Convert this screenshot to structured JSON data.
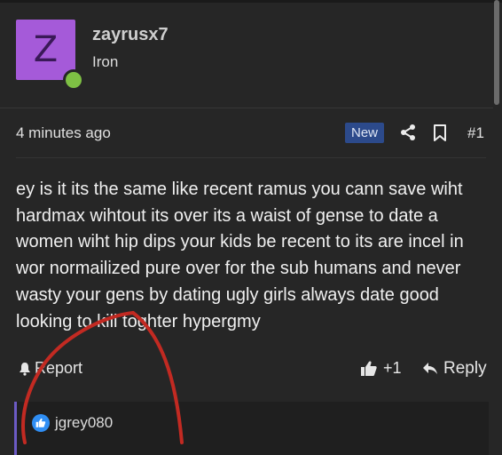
{
  "author": {
    "avatar_letter": "Z",
    "username": "zayrusx7",
    "rank": "Iron",
    "avatar_color": "#a55ad9",
    "online_color": "#7ec044"
  },
  "post_meta": {
    "time": "4 minutes ago",
    "badge": "New",
    "number": "#1",
    "share_icon": "share-icon",
    "bookmark_icon": "bookmark-icon"
  },
  "post": {
    "body": "ey is it its the same like recent ramus you cann save wiht hardmax wihtout its over its a waist of gense to date a women wiht hip dips your kids be recent to its are incel in wor normailized pure over for the sub humans and never wasty your gens by dating ugly girls always date good looking to kill toghter hypergmy"
  },
  "actions": {
    "report_label": "Report",
    "like_count": "+1",
    "reply_label": "Reply"
  },
  "quote": {
    "author": "jgrey080",
    "accent_color": "#6c5bc4"
  }
}
